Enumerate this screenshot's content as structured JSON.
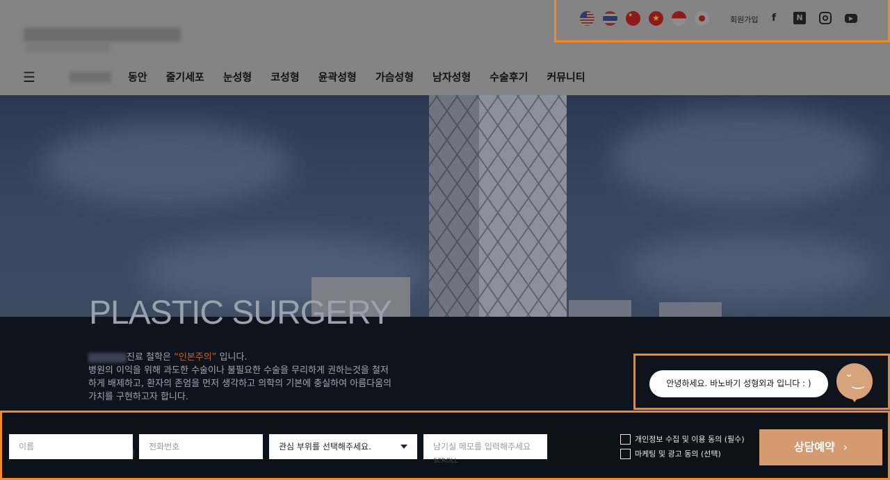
{
  "header": {
    "join_label": "회원가입",
    "nav": [
      "동안",
      "줄기세포",
      "눈성형",
      "코성형",
      "윤곽성형",
      "가슴성형",
      "남자성형",
      "수술후기",
      "커뮤니티"
    ],
    "flags": [
      "us-flag-icon",
      "thai-flag-icon",
      "china-flag-icon",
      "vietnam-flag-icon",
      "indonesia-flag-icon",
      "japan-flag-icon"
    ],
    "social_n": "N",
    "social_f": "f",
    "social_yt": "▶"
  },
  "hero": {
    "title": "PLASTIC SURGERY",
    "philosophy_line1_a": "진료 철학은 ",
    "philosophy_accent": "“인본주의”",
    "philosophy_line1_b": " 입니다.",
    "philosophy_body": "병원의 이익을 위해 과도한 수술이나 불필요한 수술을 무리하게 권하는것을 철저하게 배제하고, 환자의 존엄을 먼저 생각하고 의학의 기본에 충실하여 아름다움의 가치를 구현하고자 합니다."
  },
  "chatbot": {
    "greeting": "안녕하세요. 바노바기 성형외과 입니다 : )"
  },
  "form": {
    "name_placeholder": "이름",
    "phone_placeholder": "전화번호",
    "area_select": "관심 부위를 선택해주세요.",
    "memo_placeholder": "남기실 메모를 입력해주세요",
    "privacy_consent": "개인정보 수집 및 이용 동의 (필수)",
    "marketing_consent": "마케팅 및 광고 동의 (선택)",
    "submit_label": "상담예약",
    "scroll_label": "SCROLL"
  },
  "colors": {
    "highlight_border": "#f08a24",
    "accent": "#d49a70",
    "band_bg": "#0f141c"
  }
}
